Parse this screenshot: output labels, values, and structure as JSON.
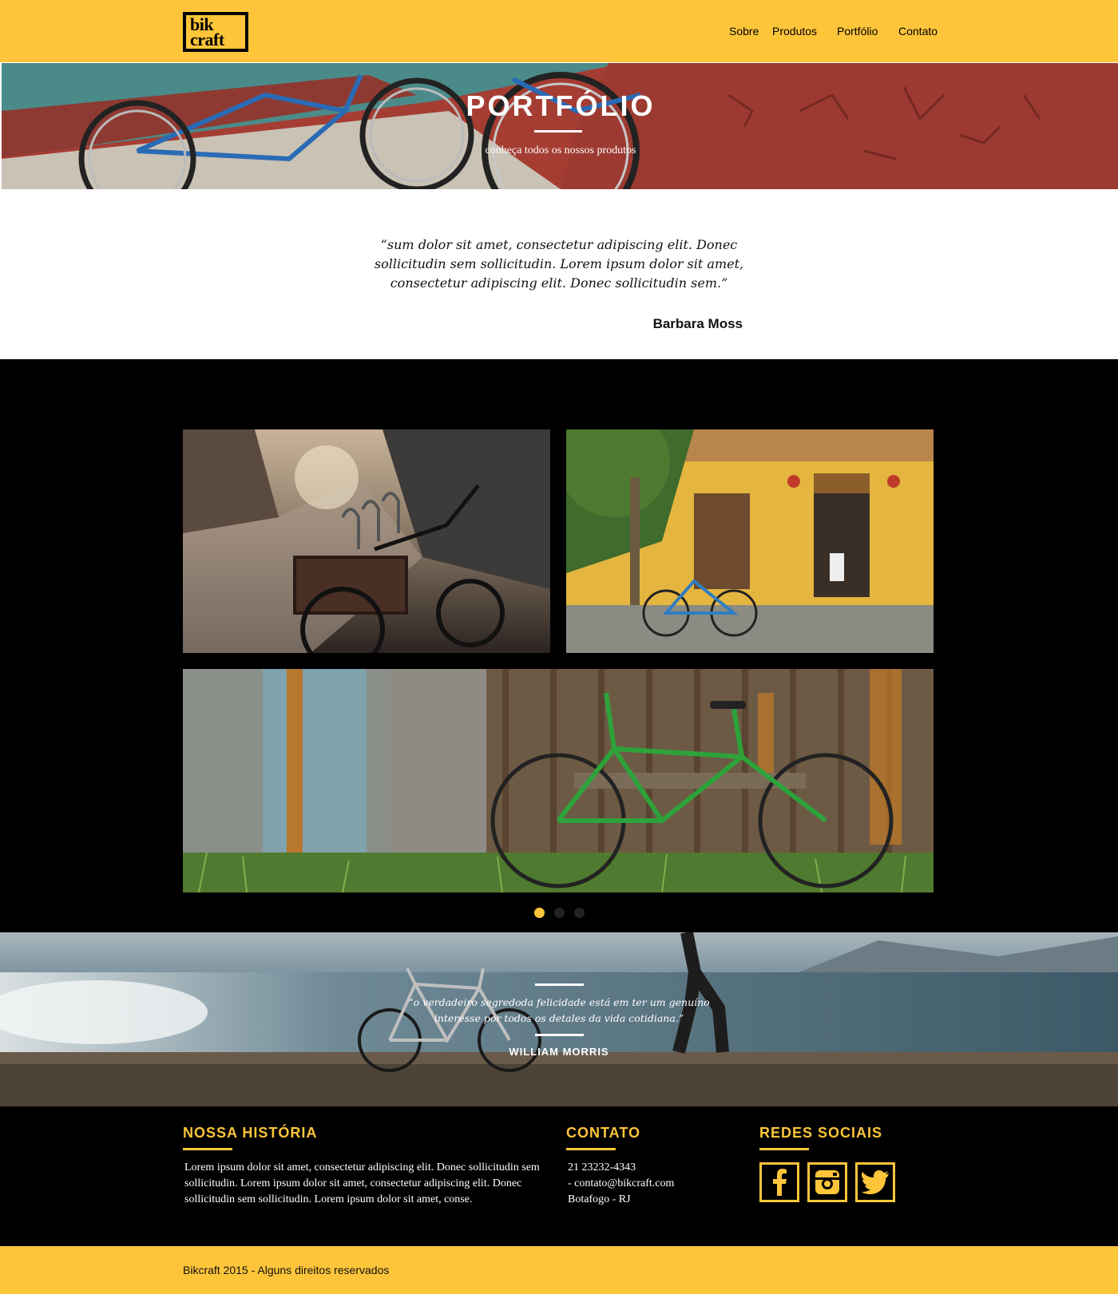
{
  "header": {
    "logo": {
      "line1": "bik",
      "line2": "craft"
    },
    "nav": [
      "Sobre",
      "Produtos",
      "Portfólio",
      "Contato"
    ]
  },
  "hero": {
    "title": "PORTFÓLIO",
    "subtitle": "conheça todos os nossos produtos"
  },
  "testimonial": {
    "quote": "“sum dolor sit amet, consectetur adipiscing elit. Donec sollicitudin sem sollicitudin. Lorem ipsum dolor sit amet, consectetur adipiscing elit. Donec sollicitudin sem.”",
    "author": "Barbara Moss"
  },
  "portfolio": {
    "photos": [
      "street-bicycle-basket-photo",
      "yellow-house-bicycle-photo",
      "green-bicycle-wooden-fence-photo"
    ],
    "slider_dots": 3,
    "active_dot": 1
  },
  "banner": {
    "quote": "“o verdadeiro segredoda felicidade está em ter um genuíno interesse por todos os detales da vida cotidiana.”",
    "author": "WILLIAM MORRIS"
  },
  "footer": {
    "history": {
      "title": "NOSSA HISTÓRIA",
      "text": "Lorem ipsum dolor sit amet, consectetur adipiscing elit. Donec sollicitudin sem sollicitudin. Lorem ipsum dolor sit amet, consectetur adipiscing elit. Donec sollicitudin sem sollicitudin. Lorem ipsum dolor sit amet, conse."
    },
    "contact": {
      "title": "CONTATO",
      "phone": "21 23232-4343",
      "email": "- contato@bikcraft.com",
      "location": "Botafogo - RJ"
    },
    "social": {
      "title": "REDES SOCIAIS",
      "icons": [
        "facebook-icon",
        "instagram-icon",
        "twitter-icon"
      ]
    }
  },
  "copyright": "Bikcraft 2015 - Alguns direitos reservados",
  "colors": {
    "accent": "#fec53a",
    "dark": "#000000"
  }
}
